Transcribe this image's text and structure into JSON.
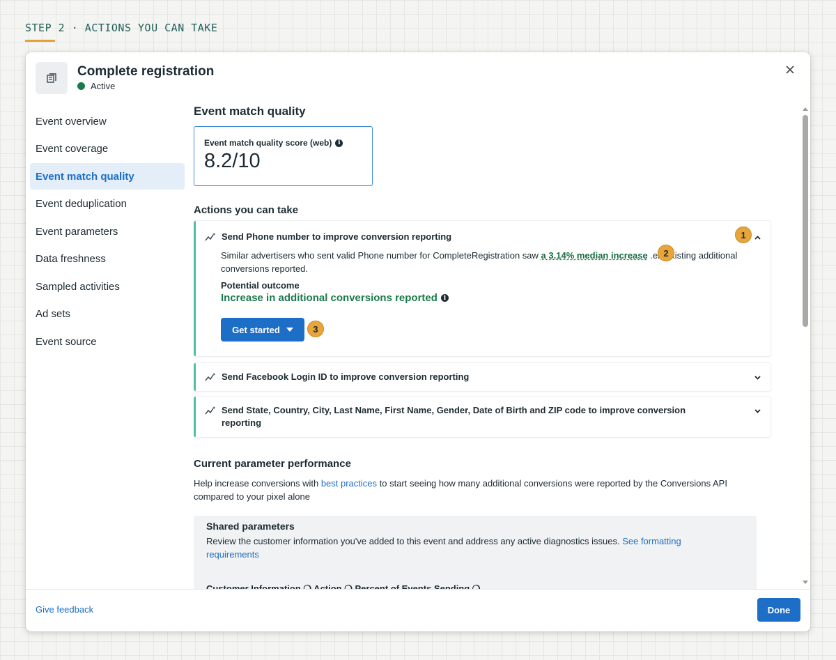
{
  "step": {
    "label": "STEP 2 · ACTIONS YOU CAN TAKE"
  },
  "modal": {
    "title": "Complete registration",
    "status": "Active",
    "icon": "event-document-icon",
    "close_icon": "close-icon"
  },
  "sidebar": {
    "items": [
      {
        "label": "Event overview",
        "active": false
      },
      {
        "label": "Event coverage",
        "active": false
      },
      {
        "label": "Event match quality",
        "active": true
      },
      {
        "label": "Event deduplication",
        "active": false
      },
      {
        "label": "Event parameters",
        "active": false
      },
      {
        "label": "Data freshness",
        "active": false
      },
      {
        "label": "Sampled activities",
        "active": false
      },
      {
        "label": "Ad sets",
        "active": false
      },
      {
        "label": "Event source",
        "active": false
      }
    ]
  },
  "main": {
    "section_title": "Event match quality",
    "score": {
      "label": "Event match quality score (web)",
      "value": "8.2/10"
    },
    "actions_title": "Actions you can take",
    "actions": [
      {
        "title": "Send Phone number to improve conversion reporting",
        "expanded": true,
        "desc_before": "Similar advertisers who sent valid Phone number for CompleteRegistration saw ",
        "desc_link": "a 3.14% median increase",
        "desc_after": " .eir existing additional conversions reported.",
        "outcome_label": "Potential outcome",
        "outcome_value": "Increase in additional conversions reported",
        "button_label": "Get started"
      },
      {
        "title": "Send Facebook Login ID to improve conversion reporting",
        "expanded": false
      },
      {
        "title_line1": "Send State, Country, City, Last Name, First Name, Gender, Date of Birth and ZIP code to improve conversion",
        "title_line2": "reporting",
        "expanded": false
      }
    ],
    "performance": {
      "title": "Current parameter performance",
      "text_before": "Help increase conversions with ",
      "link": "best practices",
      "text_line1_after": " to start seeing how many additional conversions were reported by the Conversions API",
      "text_line2": "compared to your pixel alone"
    },
    "shared": {
      "title": "Shared parameters",
      "text": "Review the customer information you've added to this event and address any active diagnostics issues. ",
      "link_line1": "See formatting",
      "link_line2": "requirements",
      "cut_headers": "Customer Information ❍          Action ❍          Percent of Events Sending ❍"
    }
  },
  "badges": [
    "1",
    "2",
    "3"
  ],
  "footer": {
    "feedback": "Give feedback",
    "done": "Done"
  },
  "colors": {
    "accent": "#1d6ec7",
    "success": "#1b7a4b",
    "badge": "#e8a53a",
    "card_border": "#4fbea0"
  }
}
